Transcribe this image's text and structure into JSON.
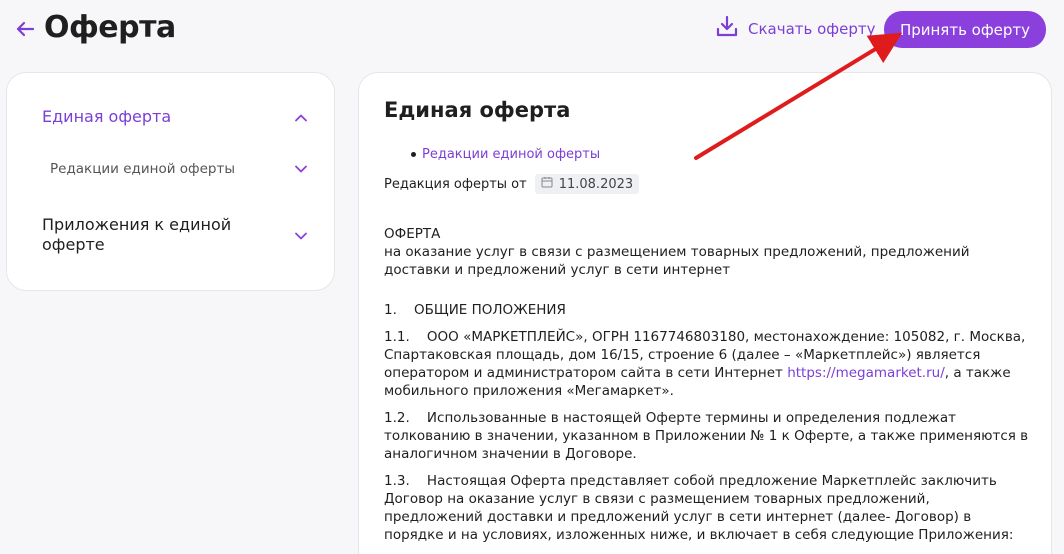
{
  "header": {
    "title": "Оферта",
    "download_label": "Скачать оферту",
    "accept_label": "Принять оферту"
  },
  "sidebar": {
    "items": [
      {
        "label": "Единая оферта",
        "state": "expanded"
      },
      {
        "label": "Редакции единой оферты",
        "state": "collapsed"
      },
      {
        "label": "Приложения к единой оферте",
        "state": "collapsed"
      }
    ]
  },
  "document": {
    "title": "Единая оферта",
    "bullet_link": "Редакции единой оферты",
    "edition_label": "Редакция оферты от",
    "edition_date": "11.08.2023",
    "heading": "ОФЕРТА",
    "subheading": "на оказание услуг в связи с размещением товарных предложений, предложений доставки и предложений услуг в сети интернет",
    "section_1": "1.    ОБЩИЕ ПОЛОЖЕНИЯ",
    "p1_1_before": "1.1.    ООО «МАРКЕТПЛЕЙС», ОГРН 1167746803180, местонахождение: 105082, г. Москва, Спартаковская площадь, дом 16/15, строение 6 (далее – «Маркетплейс») является оператором и администратором сайта в сети Интернет ",
    "p1_1_link": "https://megamarket.ru/",
    "p1_1_after": ", а также мобильного приложения «Мегамаркет».",
    "p1_2": "1.2.    Использованные в настоящей Оферте термины и определения подлежат толкованию в значении, указанном в Приложении № 1 к Оферте, а также применяются в аналогичном значении в Договоре.",
    "p1_3": "1.3.    Настоящая Оферта представляет собой предложение Маркетплейс заключить Договор на оказание услуг в связи с размещением товарных предложений, предложений доставки и предложений услуг в сети интернет (далее- Договор) в порядке и на условиях, изложенных ниже, и включает в себя следующие Приложения:"
  },
  "colors": {
    "accent": "#8b3fdc",
    "link": "#7b3fd6",
    "annotation_arrow": "#e01b1b"
  }
}
